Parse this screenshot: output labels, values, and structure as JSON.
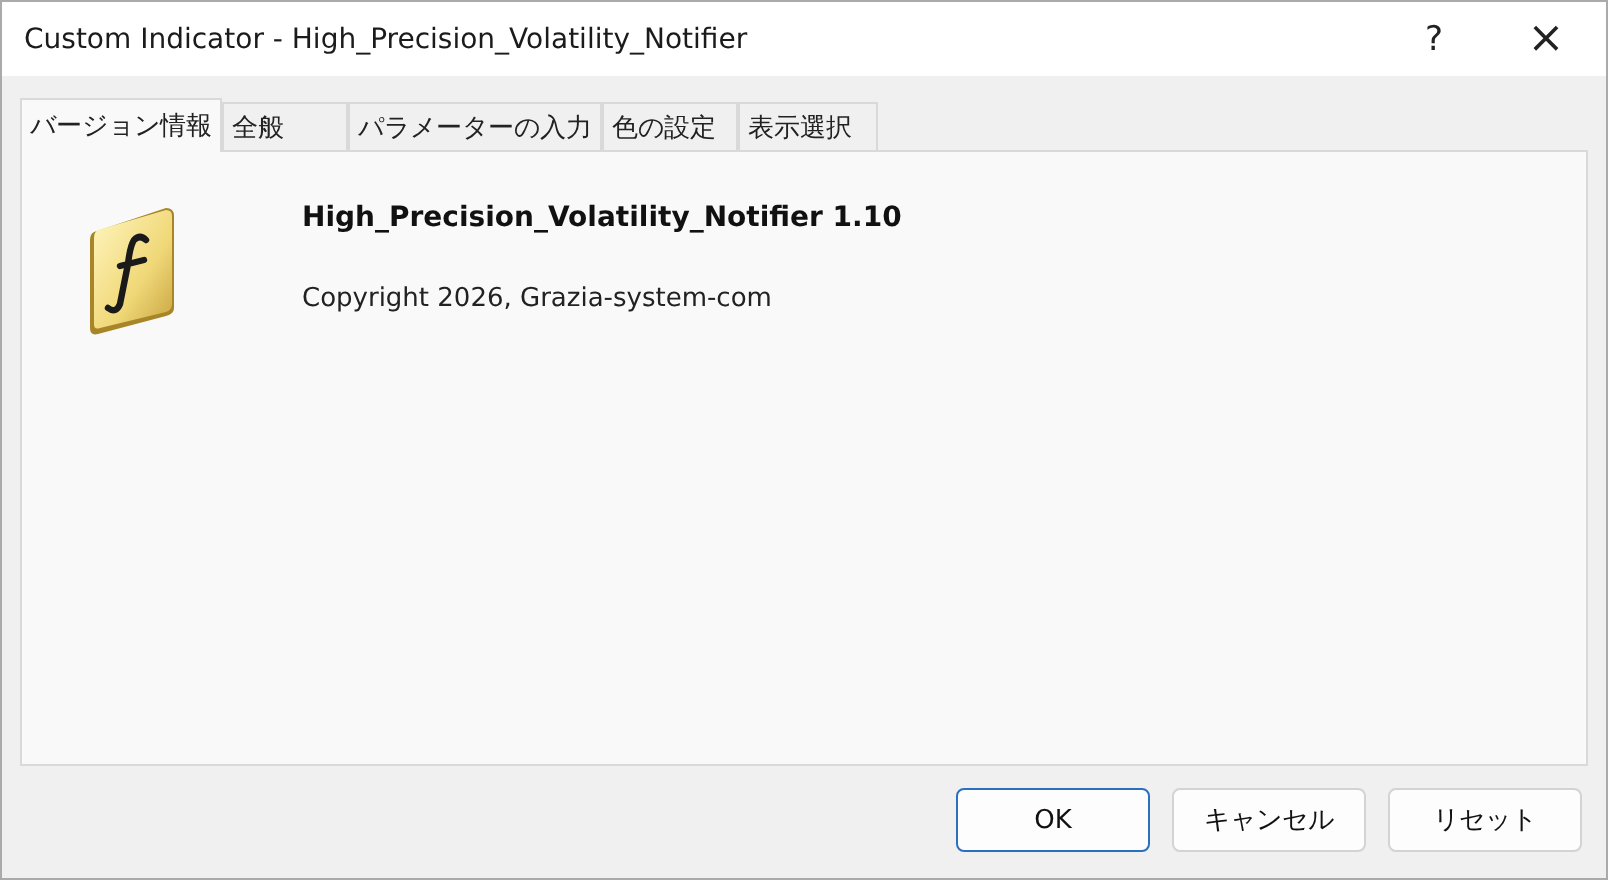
{
  "window": {
    "title": "Custom Indicator - High_Precision_Volatility_Notifier",
    "controls": [
      "?",
      "×"
    ]
  },
  "tabs": [
    {
      "label": "バージョン情報",
      "selected": true
    },
    {
      "label": "全般",
      "selected": false
    },
    {
      "label": "パラメーターの入力",
      "selected": false
    },
    {
      "label": "色の設定",
      "selected": false
    },
    {
      "label": "表示選択",
      "selected": false
    }
  ],
  "about": {
    "name": "High_Precision_Volatility_Notifier 1.10",
    "copyright": "Copyright 2026, Grazia-system-com"
  },
  "buttons": [
    {
      "label": "OK",
      "default": true
    },
    {
      "label": "キャンセル",
      "default": false
    },
    {
      "label": "リセット",
      "default": false
    }
  ]
}
